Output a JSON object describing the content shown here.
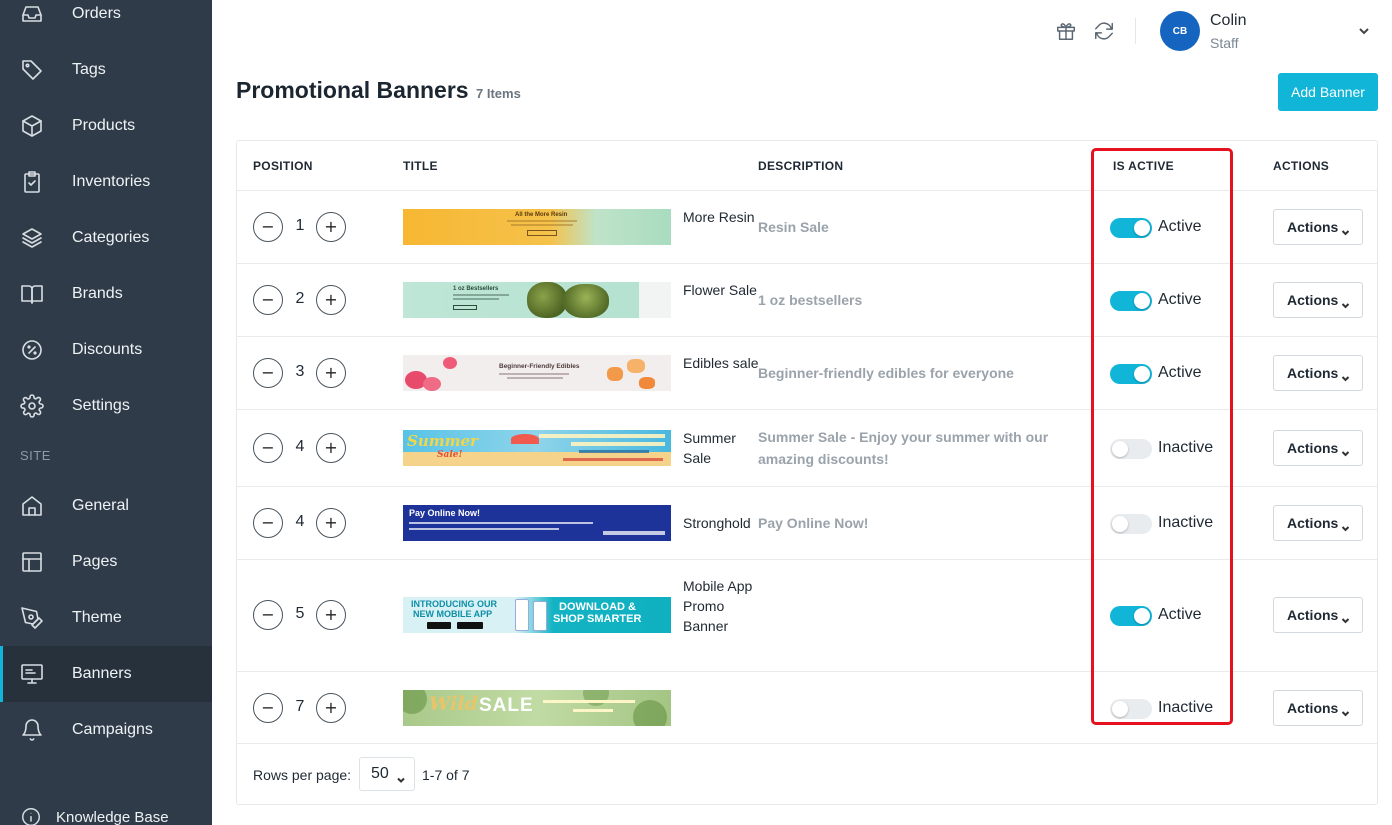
{
  "sidebar": {
    "items": [
      {
        "label": "Orders",
        "icon": "inbox-icon"
      },
      {
        "label": "Tags",
        "icon": "tag-icon"
      },
      {
        "label": "Products",
        "icon": "box-icon"
      },
      {
        "label": "Inventories",
        "icon": "clipboard-icon"
      },
      {
        "label": "Categories",
        "icon": "layers-icon"
      },
      {
        "label": "Brands",
        "icon": "book-icon"
      },
      {
        "label": "Discounts",
        "icon": "percent-icon"
      },
      {
        "label": "Settings",
        "icon": "gear-icon"
      }
    ],
    "section_label": "SITE",
    "site_items": [
      {
        "label": "General",
        "icon": "home-icon"
      },
      {
        "label": "Pages",
        "icon": "layout-icon"
      },
      {
        "label": "Theme",
        "icon": "pen-tool-icon"
      },
      {
        "label": "Banners",
        "icon": "monitor-icon",
        "active": true
      },
      {
        "label": "Campaigns",
        "icon": "bell-icon"
      }
    ],
    "knowledge_base": "Knowledge Base"
  },
  "header": {
    "user_initials": "CB",
    "user_name": "Colin",
    "user_role": "Staff"
  },
  "page": {
    "title": "Promotional Banners",
    "count": "7 Items",
    "add_button": "Add Banner"
  },
  "table": {
    "columns": [
      "POSITION",
      "TITLE",
      "DESCRIPTION",
      "IS ACTIVE",
      "ACTIONS"
    ],
    "rows": [
      {
        "position": "1",
        "title": "More Resin",
        "description": "Resin Sale",
        "active": true,
        "status": "Active",
        "action": "Actions",
        "banner": {
          "line1": "All the More Resin"
        }
      },
      {
        "position": "2",
        "title": "Flower Sale",
        "description": "1 oz bestsellers",
        "active": true,
        "status": "Active",
        "action": "Actions",
        "banner": {
          "line1": "1 oz Bestsellers"
        }
      },
      {
        "position": "3",
        "title": "Edibles sale",
        "description": "Beginner-friendly edibles for everyone",
        "active": true,
        "status": "Active",
        "action": "Actions",
        "banner": {
          "line1": "Beginner-Friendly Edibles"
        }
      },
      {
        "position": "4",
        "title": "Summer Sale",
        "description": "Summer Sale - Enjoy your summer with our amazing discounts!",
        "active": false,
        "status": "Inactive",
        "action": "Actions",
        "banner": {
          "line1": "Summer",
          "line2": "Sale!"
        }
      },
      {
        "position": "4",
        "title": "Stronghold",
        "description": "Pay Online Now!",
        "active": false,
        "status": "Inactive",
        "action": "Actions",
        "banner": {
          "line1": "Pay Online Now!"
        }
      },
      {
        "position": "5",
        "title": "Mobile App Promo Banner",
        "description": "",
        "active": true,
        "status": "Active",
        "action": "Actions",
        "banner": {
          "line1": "INTRODUCING OUR",
          "line2": "NEW MOBILE APP",
          "line3": "DOWNLOAD &",
          "line4": "SHOP SMARTER"
        }
      },
      {
        "position": "7",
        "title": "",
        "description": "",
        "active": false,
        "status": "Inactive",
        "action": "Actions",
        "banner": {
          "line1": "Wild",
          "line2": "SALE"
        }
      }
    ]
  },
  "footer": {
    "rows_label": "Rows per page:",
    "rows_value": "50",
    "range": "1-7 of 7"
  },
  "colors": {
    "sidebar_bg": "#2f3b48",
    "accent": "#10b5d8",
    "highlight": "#e5111f"
  }
}
